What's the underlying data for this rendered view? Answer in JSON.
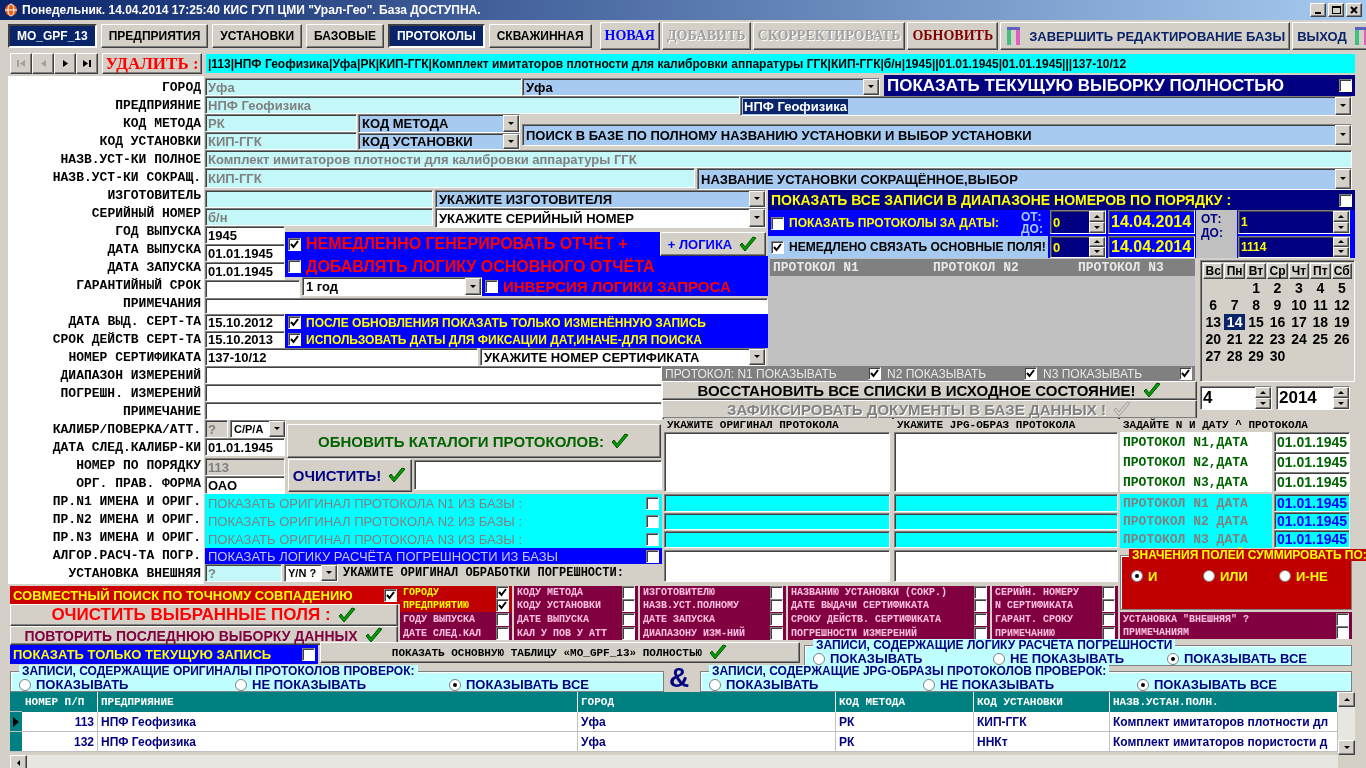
{
  "window": {
    "title": "Понедельник. 14.04.2014 17:25:40  КИС ГУП ЦМИ \"Урал-Гео\". База ДОСТУПНА."
  },
  "tabs": [
    {
      "label": "MO_GPF_13",
      "selected": true
    },
    {
      "label": "ПРЕДПРИЯТИЯ",
      "selected": false
    },
    {
      "label": "УСТАНОВКИ",
      "selected": false
    },
    {
      "label": "БАЗОВЫЕ",
      "selected": false
    },
    {
      "label": "ПРОТОКОЛЫ",
      "selected": true
    },
    {
      "label": "СКВАЖИННАЯ",
      "selected": false
    }
  ],
  "actions": [
    {
      "kind": "new",
      "label": "НОВАЯ",
      "disabled": false
    },
    {
      "kind": "add",
      "label": "ДОБАВИТЬ",
      "disabled": true
    },
    {
      "kind": "edit",
      "label": "СКОРРЕКТИРОВАТЬ",
      "disabled": true
    },
    {
      "kind": "refresh",
      "label": "ОБНОВИТЬ",
      "disabled": false
    },
    {
      "kind": "finish",
      "label": "ЗАВЕРШИТЬ РЕДАКТИРОВАНИЕ БАЗЫ",
      "disabled": false
    },
    {
      "kind": "exit",
      "label": "ВЫХОД",
      "disabled": false
    }
  ],
  "navigator": [
    {
      "kind": "first",
      "disabled": true
    },
    {
      "kind": "prev",
      "disabled": true
    },
    {
      "kind": "next",
      "disabled": false
    },
    {
      "kind": "last",
      "disabled": false
    }
  ],
  "delete_button": "УДАЛИТЬ :",
  "record_line": "|113|НПФ Геофизика|Уфа|РК|КИП-ГГК|Комплект имитаторов плотности для калибровки аппаратуры ГГК|КИП-ГГК|б/н|1945||01.01.1945|01.01.1945|||137-10/12",
  "form_labels": [
    "ГОРОД",
    "ПРЕДПРИЯНИЕ",
    "КОД МЕТОДА",
    "КОД УСТАНОВКИ",
    "НАЗВ.УСТ-КИ ПОЛНОЕ",
    "НАЗВ.УСТ-КИ СОКРАЩ.",
    "ИЗГОТОВИТЕЛЬ",
    "СЕРИЙНЫЙ НОМЕР",
    "ГОД ВЫПУСКА",
    "ДАТА ВЫПУСКА",
    "ДАТА ЗАПУСКА",
    "ГАРАНТИЙНЫЙ СРОК",
    "ПРИМЕЧАНИЯ",
    "ДАТА ВЫД. СЕРТ-ТА",
    "СРОК ДЕЙСТВ СЕРТ-ТА",
    "НОМЕР СЕРТИФИКАТА",
    "ДИАПАЗОН ИЗМЕРЕНИЙ",
    "ПОГРЕШН. ИЗМЕРЕНИЙ",
    "ПРИМЕЧАНИЕ",
    "КАЛИБР/ПОВЕРКА/АТТ.",
    "ДАТА СЛЕД.КАЛИБР-КИ",
    "НОМЕР ПО ПОРЯДКУ",
    "ОРГ. ПРАВ. ФОРМА",
    "ПР.N1 ИМЕНА И ОРИГ.",
    "ПР.N2 ИМЕНА И ОРИГ.",
    "ПР.N3 ИМЕНА И ОРИГ.",
    "АЛГОР.РАСЧ-ТА ПОГР.",
    "УСТАНОВКА ВНЕШНЯЯ"
  ],
  "controls": [
    {
      "kind": "field",
      "value": "Уфа"
    },
    {
      "kind": "combo",
      "value": "Уфа"
    },
    {
      "kind": "check",
      "label": "ПОКАЗАТЬ ТЕКУЩУЮ ВЫБОРКУ ПОЛНОСТЬЮ",
      "checked": false
    },
    {
      "kind": "field",
      "value": "НПФ Геофизика"
    },
    {
      "kind": "combo",
      "value": "НПФ Геофизика"
    },
    {
      "kind": "field",
      "value": "РК"
    },
    {
      "kind": "combo",
      "value": "КОД МЕТОДА"
    },
    {
      "kind": "combo",
      "value": "ПОИСК В БАЗЕ ПО ПОЛНОМУ НАЗВАНИЮ УСТАНОВКИ И ВЫБОР УСТАНОВКИ"
    },
    {
      "kind": "field",
      "value": "КИП-ГГК"
    },
    {
      "kind": "combo",
      "value": "КОД УСТАНОВКИ"
    },
    {
      "kind": "field",
      "value": "Комплект имитаторов плотности для калибровки аппаратуры ГГК"
    },
    {
      "kind": "field",
      "value": "КИП-ГГК"
    },
    {
      "kind": "combo",
      "value": "НАЗВАНИЕ УСТАНОВКИ СОКРАЩЁННОЕ,ВЫБОР"
    },
    {
      "kind": "field"
    },
    {
      "kind": "combo",
      "value": "УКАЖИТЕ ИЗГОТОВИТЕЛЯ"
    },
    {
      "kind": "field",
      "value": "б/н"
    },
    {
      "kind": "combo",
      "value": "УКАЖИТЕ СЕРИЙНЫЙ НОМЕР"
    },
    {
      "kind": "field",
      "value": "1945"
    },
    {
      "kind": "field",
      "value": "01.01.1945"
    },
    {
      "kind": "field",
      "value": "01.01.1945"
    },
    {
      "kind": "field"
    },
    {
      "kind": "combo",
      "value": "1 год"
    },
    {
      "kind": "field"
    },
    {
      "kind": "field",
      "value": "15.10.2012"
    },
    {
      "kind": "field",
      "value": "15.10.2013"
    },
    {
      "kind": "field",
      "value": "137-10/12"
    },
    {
      "kind": "combo",
      "value": "УКАЖИТЕ НОМЕР СЕРТИФИКАТА"
    },
    {
      "kind": "field"
    },
    {
      "kind": "field"
    },
    {
      "kind": "field"
    },
    {
      "kind": "field",
      "value": "?"
    },
    {
      "kind": "combo",
      "value": "С/Р/А"
    },
    {
      "kind": "field",
      "value": "01.01.1945"
    },
    {
      "kind": "field",
      "value": "113"
    },
    {
      "kind": "field",
      "value": "ОАО"
    },
    {
      "kind": "field",
      "value": "?"
    },
    {
      "kind": "combo",
      "value": "Y/N ?"
    },
    {
      "kind": "check",
      "label": "НЕМЕДЛЕННО ГЕНЕРИРОВАТЬ ОТЧЁТ +",
      "checked": true
    },
    {
      "kind": "button",
      "label": "+ ЛОГИКА",
      "disabled": false
    },
    {
      "kind": "check",
      "label": "ДОБАВЛЯТЬ ЛОГИКУ ОСНОВНОГО ОТЧЁТА",
      "checked": false
    },
    {
      "kind": "check",
      "label": "ИНВЕРСИЯ ЛОГИКИ ЗАПРОСА",
      "checked": false
    },
    {
      "kind": "check",
      "label": "ПОСЛЕ ОБНОВЛЕНИЯ ПОКАЗАТЬ ТОЛЬКО ИЗМЕНЁННУЮ ЗАПИСЬ",
      "checked": true
    },
    {
      "kind": "check",
      "label": "ИСПОЛЬЗОВАТЬ ДАТЫ ДЛЯ ФИКСАЦИИ ДАТ,ИНАЧЕ-ДЛЯ ПОИСКА",
      "checked": true
    },
    {
      "kind": "check",
      "label": "ПОКАЗАТЬ ВСЕ ЗАПИСИ В ДИАПАЗОНЕ НОМЕРОВ ПО ПОРЯДКУ :",
      "checked": false
    },
    {
      "kind": "check",
      "label": "ПОКАЗАТЬ ПРОТОКОЛЫ ЗА ДАТЫ:",
      "checked": false
    },
    {
      "kind": "text",
      "label": "ОТ:"
    },
    {
      "kind": "text",
      "label": "ДО:"
    },
    {
      "kind": "spin",
      "value": "0"
    },
    {
      "kind": "field",
      "value": "14.04.2014"
    },
    {
      "kind": "text",
      "label": "ОТ:"
    },
    {
      "kind": "text",
      "label": "ДО:"
    },
    {
      "kind": "spin",
      "value": "1"
    },
    {
      "kind": "check",
      "label": "НЕМЕДЛЕНО СВЯЗАТЬ ОСНОВНЫЕ ПОЛЯ!",
      "checked": true
    },
    {
      "kind": "spin",
      "value": "0"
    },
    {
      "kind": "field",
      "value": "14.04.2014"
    },
    {
      "kind": "spin",
      "value": "1114"
    },
    {
      "kind": "text",
      "label": "ПРОТОКОЛ N1"
    },
    {
      "kind": "text",
      "label": "ПРОТОКОЛ N2"
    },
    {
      "kind": "text",
      "label": "ПРОТОКОЛ N3"
    },
    {
      "kind": "check",
      "label": "ПРОТОКОЛ:  N1  ПОКАЗЫВАТЬ",
      "checked": true
    },
    {
      "kind": "check",
      "label": "N2 ПОКАЗЫВАТЬ",
      "checked": true
    },
    {
      "kind": "check",
      "label": "N3  ПОКАЗЫВАТЬ",
      "checked": true
    },
    {
      "kind": "button",
      "label": "ВОССТАНОВИТЬ ВСЕ СПИСКИ В ИСХОДНОЕ СОСТОЯНИЕ!",
      "disabled": false
    },
    {
      "kind": "button",
      "label": "ЗАФИКСИРОВАТЬ ДОКУМЕНТЫ В БАЗЕ ДАННЫХ !",
      "disabled": true
    },
    {
      "kind": "spin",
      "value": "4"
    },
    {
      "kind": "spin",
      "value": "2014"
    },
    {
      "kind": "button",
      "label": "ОБНОВИТЬ КАТАЛОГИ ПРОТОКОЛОВ:",
      "disabled": false
    },
    {
      "kind": "button",
      "label": "ОЧИСТИТЬ!",
      "disabled": false
    },
    {
      "kind": "field"
    },
    {
      "kind": "check",
      "label": "ПОКАЗАТЬ ОРИГИНАЛ ПРОТОКОЛА N1 ИЗ БАЗЫ :",
      "checked": false
    },
    {
      "kind": "check",
      "label": "ПОКАЗАТЬ ОРИГИНАЛ ПРОТОКОЛА N2 ИЗ БАЗЫ :",
      "checked": false
    },
    {
      "kind": "check",
      "label": "ПОКАЗАТЬ ОРИГИНАЛ ПРОТОКОЛА N3 ИЗ БАЗЫ :",
      "checked": false
    },
    {
      "kind": "check",
      "label": "ПОКАЗАТЬ ЛОГИКУ РАСЧЁТА ПОГРЕШНОСТИ ИЗ БАЗЫ",
      "checked": false
    },
    {
      "kind": "text",
      "label": "УКАЖИТЕ ОРИГИНАЛ ОБРАБОТКИ ПОГРЕШНОСТИ:"
    },
    {
      "kind": "text",
      "label": "УКАЖИТЕ ОРИГИНАЛ ПРОТОКОЛА"
    },
    {
      "kind": "text",
      "label": "УКАЖИТЕ JPG-ОБРАЗ ПРОТОКОЛА"
    },
    {
      "kind": "text",
      "label": "ЗАДАЙТЕ N И ДАТУ ^ ПРОТОКОЛА"
    },
    {
      "kind": "field"
    },
    {
      "kind": "field"
    },
    {
      "kind": "text",
      "label": "ПРОТОКОЛ N1,ДАТА"
    },
    {
      "kind": "field",
      "value": "01.01.1945"
    },
    {
      "kind": "text",
      "label": "ПРОТОКОЛ N2,ДАТА"
    },
    {
      "kind": "field",
      "value": "01.01.1945"
    },
    {
      "kind": "text",
      "label": "ПРОТОКОЛ N3,ДАТА"
    },
    {
      "kind": "field",
      "value": "01.01.1945"
    },
    {
      "kind": "field"
    },
    {
      "kind": "field"
    },
    {
      "kind": "text",
      "label": "ПРОТОКОЛ N1 ДАТА"
    },
    {
      "kind": "field",
      "value": "01.01.1945"
    },
    {
      "kind": "field"
    },
    {
      "kind": "field"
    },
    {
      "kind": "text",
      "label": "ПРОТОКОЛ N2 ДАТА"
    },
    {
      "kind": "field",
      "value": "01.01.1945"
    },
    {
      "kind": "field"
    },
    {
      "kind": "field"
    },
    {
      "kind": "text",
      "label": "ПРОТОКОЛ N3 ДАТА"
    },
    {
      "kind": "field",
      "value": "01.01.1945"
    },
    {
      "kind": "field"
    },
    {
      "kind": "field"
    },
    {
      "kind": "group",
      "label": "ЗНАЧЕНИЯ ПОЛЕЙ СУММИРОВАТЬ ПО:"
    },
    {
      "kind": "radio",
      "label": "И",
      "selected": true
    },
    {
      "kind": "radio",
      "label": "ИЛИ",
      "selected": false
    },
    {
      "kind": "radio",
      "label": "И-НЕ",
      "selected": false
    },
    {
      "kind": "check",
      "label": "СОВМЕСТНЫЙ ПОИСК ПО ТОЧНОМУ СОВПАДЕНИЮ",
      "checked": true
    },
    {
      "kind": "button",
      "label": "ОЧИСТИТЬ  ВЫБРАННЫЕ  ПОЛЯ :",
      "disabled": false
    },
    {
      "kind": "button",
      "label": "ПОВТОРИТЬ ПОСЛЕДНЮЮ ВЫБОРКУ ДАННЫХ",
      "disabled": false
    },
    {
      "kind": "check",
      "label": "ГОРОДУ",
      "checked": true
    },
    {
      "kind": "check",
      "label": "ПРЕДПРИЯТИЮ",
      "checked": true
    },
    {
      "kind": "check",
      "label": "ГОДУ ВЫПУСКА",
      "checked": false
    },
    {
      "kind": "check",
      "label": "ДАТЕ СЛЕД.КАЛ",
      "checked": false
    },
    {
      "kind": "check",
      "label": "КОДУ МЕТОДА",
      "checked": false
    },
    {
      "kind": "check",
      "label": "КОДУ УСТАНОВКИ",
      "checked": false
    },
    {
      "kind": "check",
      "label": "ДАТЕ ВЫПУСКА",
      "checked": false
    },
    {
      "kind": "check",
      "label": "КАЛ У ПОВ У АТТ",
      "checked": false
    },
    {
      "kind": "check",
      "label": "ИЗГОТОВИТЕЛЮ",
      "checked": false
    },
    {
      "kind": "check",
      "label": "НАЗВ.УСТ.ПОЛНОМУ",
      "checked": false
    },
    {
      "kind": "check",
      "label": "ДАТЕ ЗАПУСКА",
      "checked": false
    },
    {
      "kind": "check",
      "label": "ДИАПАЗОНУ ИЗМ-НИЙ",
      "checked": false
    },
    {
      "kind": "check",
      "label": "НАЗВАНИЮ УСТАНОВКИ (СОКР.)",
      "checked": false
    },
    {
      "kind": "check",
      "label": "ДАТЕ ВЫДАЧИ СЕРТИФИКАТА",
      "checked": false
    },
    {
      "kind": "check",
      "label": "СРОКУ ДЕЙСТВ. СЕРТИФИКАТА",
      "checked": false
    },
    {
      "kind": "check",
      "label": "ПОГРЕШНОСТИ ИЗМЕРЕНИЙ",
      "checked": false
    },
    {
      "kind": "check",
      "label": "СЕРИЙН. НОМЕРУ",
      "checked": false
    },
    {
      "kind": "check",
      "label": "N СЕРТИФИКАТА",
      "checked": false
    },
    {
      "kind": "check",
      "label": "ГАРАНТ. СРОКУ",
      "checked": false
    },
    {
      "kind": "check",
      "label": "ПРИМЕЧАНИЮ",
      "checked": false
    },
    {
      "kind": "check",
      "label": "УСТАНОВКА \"ВНЕШНЯЯ\" ?",
      "checked": false
    },
    {
      "kind": "check",
      "label": "ПРИМЕЧАНИЯМ",
      "checked": false
    },
    {
      "kind": "check",
      "label": "ПОКАЗАТЬ ТОЛЬКО ТЕКУЩУЮ ЗАПИСЬ",
      "checked": false
    },
    {
      "kind": "button",
      "label": "ПОКАЗАТЬ ОСНОВНУЮ ТАБЛИЦУ «MO_GPF_13» ПОЛНОСТЬЮ",
      "disabled": false
    },
    {
      "kind": "group",
      "label": "ЗАПИСИ, СОДЕРЖАЩИЕ ЛОГИКУ  РАСЧЁТА ПОГРЕШНОСТИ"
    },
    {
      "kind": "radio",
      "label": "ПОКАЗЫВАТЬ",
      "selected": false
    },
    {
      "kind": "radio",
      "label": "НЕ ПОКАЗЫВАТЬ",
      "selected": false
    },
    {
      "kind": "radio",
      "label": "ПОКАЗЫВАТЬ ВСЕ",
      "selected": true
    },
    {
      "kind": "group",
      "label": "ЗАПИСИ, СОДЕРЖАЩИЕ ОРИГИНАЛЫ ПРОТОКОЛОВ ПРОВЕРОК:"
    },
    {
      "kind": "radio",
      "label": "ПОКАЗЫВАТЬ",
      "selected": false
    },
    {
      "kind": "radio",
      "label": "НЕ ПОКАЗЫВАТЬ",
      "selected": false
    },
    {
      "kind": "radio",
      "label": "ПОКАЗЫВАТЬ ВСЕ",
      "selected": true
    },
    {
      "kind": "text",
      "label": "&"
    },
    {
      "kind": "group",
      "label": "ЗАПИСИ, СОДЕРЖАЩИЕ JPG-ОБРАЗЫ ПРОТОКОЛОВ ПРОВЕРОК:"
    },
    {
      "kind": "radio",
      "label": "ПОКАЗЫВАТЬ",
      "selected": false
    },
    {
      "kind": "radio",
      "label": "НЕ ПОКАЗЫВАТЬ",
      "selected": false
    },
    {
      "kind": "radio",
      "label": "ПОКАЗЫВАТЬ ВСЕ",
      "selected": true
    }
  ],
  "calendar": {
    "day_names": [
      "Вс",
      "Пн",
      "Вт",
      "Ср",
      "Чт",
      "Пт",
      "Сб"
    ],
    "weeks": [
      {
        "right_aligned": true,
        "days": [
          {
            "label": "1",
            "selected": false
          },
          {
            "label": "2",
            "selected": false
          },
          {
            "label": "3",
            "selected": false
          },
          {
            "label": "4",
            "selected": false
          },
          {
            "label": "5",
            "selected": false
          }
        ]
      },
      {
        "days": [
          {
            "label": "6",
            "selected": false
          },
          {
            "label": "7",
            "selected": false
          },
          {
            "label": "8",
            "selected": false
          },
          {
            "label": "9",
            "selected": false
          },
          {
            "label": "10",
            "selected": false
          },
          {
            "label": "11",
            "selected": false
          },
          {
            "label": "12",
            "selected": false
          }
        ]
      },
      {
        "days": [
          {
            "label": "13",
            "selected": false
          },
          {
            "label": "14",
            "selected": true
          },
          {
            "label": "15",
            "selected": false
          },
          {
            "label": "16",
            "selected": false
          },
          {
            "label": "17",
            "selected": false
          },
          {
            "label": "18",
            "selected": false
          },
          {
            "label": "19",
            "selected": false
          }
        ]
      },
      {
        "days": [
          {
            "label": "20",
            "selected": false
          },
          {
            "label": "21",
            "selected": false
          },
          {
            "label": "22",
            "selected": false
          },
          {
            "label": "23",
            "selected": false
          },
          {
            "label": "24",
            "selected": false
          },
          {
            "label": "25",
            "selected": false
          },
          {
            "label": "26",
            "selected": false
          }
        ]
      },
      {
        "right_aligned": false,
        "days": [
          {
            "label": "27",
            "selected": false
          },
          {
            "label": "28",
            "selected": false
          },
          {
            "label": "29",
            "selected": false
          },
          {
            "label": "30",
            "selected": false
          }
        ]
      }
    ]
  },
  "table": {
    "columns": [
      "НОМЕР П/П",
      "ПРЕДПРИЯНИЕ",
      "ГОРОД",
      "КОД МЕТОДА",
      "КОД УСТАНОВКИ",
      "НАЗВ.УСТАН.ПОЛН."
    ],
    "rows": [
      {
        "current": true,
        "cells": [
          "113",
          "НПФ Геофизика",
          "Уфа",
          "РК",
          "КИП-ГГК",
          "Комплект имитаторов плотности дл"
        ]
      },
      {
        "current": false,
        "cells": [
          "132",
          "НПФ Геофизика",
          "Уфа",
          "РК",
          "ННКт",
          "Комплект имитаторов пористости д"
        ]
      }
    ]
  }
}
